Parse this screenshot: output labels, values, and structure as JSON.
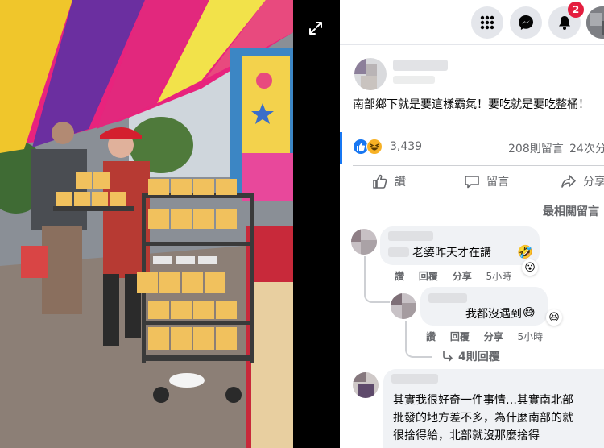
{
  "icons": {
    "expand": "expand-icon",
    "menu": "grid-menu-icon",
    "messenger": "messenger-icon",
    "notifications": "bell-icon",
    "like": "thumbs-up-icon",
    "comment": "comment-bubble-icon",
    "share": "share-arrow-icon"
  },
  "colors": {
    "accent": "#1877f2",
    "badge": "#e41e3f",
    "secondary_text": "#65676b",
    "bubble": "#f0f2f5"
  },
  "header": {
    "notification_count": "2"
  },
  "post": {
    "text": "南部鄉下就是要這樣霸氣！要吃就是要吃整桶！",
    "reaction_count": "3,439",
    "comment_count": "208則留言",
    "share_count": "24次分"
  },
  "actions": {
    "like_label": "讚",
    "comment_label": "留言",
    "share_label": "分享"
  },
  "sort": {
    "label": "最相關留言"
  },
  "comments": [
    {
      "text": "老婆昨天才在講",
      "like": "讚",
      "reply": "回覆",
      "share": "分享",
      "time": "5小時"
    },
    {
      "text": "我都沒遇到",
      "like": "讚",
      "reply": "回覆",
      "share": "分享",
      "time": "5小時"
    },
    {
      "lines": [
        "其實我很好奇一件事情…其實南北部",
        "批發的地方差不多，為什麼南部的就",
        "很捨得給，北部就沒那麼捨得"
      ]
    }
  ],
  "more_replies": {
    "label": "4則回覆"
  }
}
